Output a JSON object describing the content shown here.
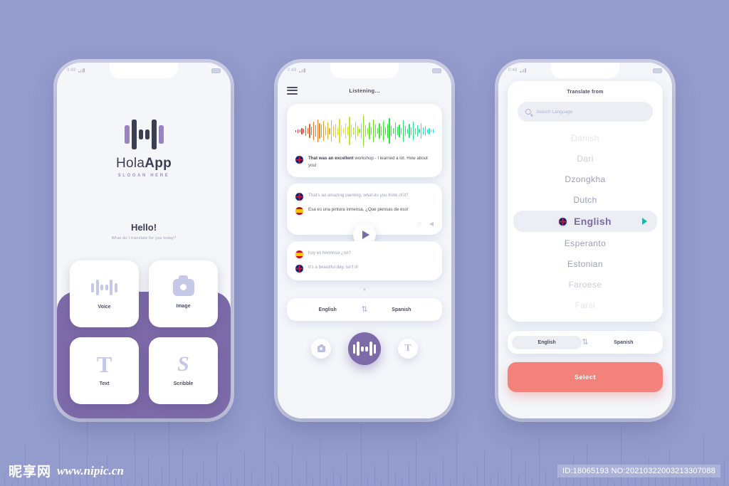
{
  "background": {
    "color": "#949ccd",
    "bar_color": "#8790c6"
  },
  "theme": {
    "purple": "#7d6aa8",
    "coral": "#f4827c",
    "teal": "#1bb8a6",
    "icon_lavender": "#c6c8e8"
  },
  "status_bar": {
    "time": "0:48",
    "battery": "battery-icon",
    "signal": "signal-icon"
  },
  "phone1": {
    "brand_a": "Hola",
    "brand_b": "App",
    "slogan": "SLOGAN HERE",
    "greeting": "Hello!",
    "greeting_sub": "What do I translate for you today?",
    "cards": [
      {
        "label": "Voice",
        "icon": "waveform-icon"
      },
      {
        "label": "Image",
        "icon": "camera-icon"
      },
      {
        "label": "Text",
        "icon": "text-icon"
      },
      {
        "label": "Scribble",
        "icon": "scribble-icon"
      }
    ]
  },
  "phone2": {
    "menu_icon": "hamburger-icon",
    "title": "Listening...",
    "waveform": "rainbow-waveform",
    "bubble1": {
      "flag": "flag-uk",
      "text_bold": "That was an excellent",
      "text_rest": " workshop - I learned a lot. How about you!"
    },
    "bubble2": {
      "line1": {
        "flag": "flag-uk",
        "text": "That's an amazing painting, what do you think of it?"
      },
      "line2": {
        "flag": "flag-es",
        "text": "Esa es una pintura inmensa, ¿Que piensas de eso!"
      },
      "action_like": "thumbs-up-icon",
      "action_share": "share-icon",
      "play": "play-icon"
    },
    "bubble3": {
      "line1": {
        "flag": "flag-es",
        "text": "hoy es hermoso ¿no?"
      },
      "line2": {
        "flag": "flag-uk",
        "text": "It's a beautiful day, isn't it!"
      },
      "chevron": "chevron-down-icon"
    },
    "lang_from": "English",
    "lang_to": "Spanish",
    "swap_icon": "swap-icon",
    "nav": [
      {
        "name": "camera",
        "icon": "camera-icon",
        "active": false
      },
      {
        "name": "voice",
        "icon": "waveform-icon",
        "active": true
      },
      {
        "name": "text",
        "icon": "text-icon",
        "active": false
      }
    ]
  },
  "phone3": {
    "title": "Translate from",
    "search_placeholder": "Search Language",
    "search_icon": "search-icon",
    "languages": [
      {
        "name": "Danish",
        "state": "faded-top"
      },
      {
        "name": "Dari",
        "state": "f1"
      },
      {
        "name": "Dzongkha",
        "state": "f2"
      },
      {
        "name": "Dutch",
        "state": "f2"
      },
      {
        "name": "English",
        "state": "selected",
        "flag": "flag-uk",
        "arrow": "play-arrow-icon"
      },
      {
        "name": "Esperanto",
        "state": "f2"
      },
      {
        "name": "Estonian",
        "state": "f2"
      },
      {
        "name": "Faroese",
        "state": "f3"
      },
      {
        "name": "Farsi",
        "state": "f4"
      }
    ],
    "lang_from": "English",
    "lang_to": "Spanish",
    "swap_icon": "swap-icon",
    "select_label": "Select"
  },
  "watermark": {
    "site_cn": "昵享网",
    "url": "www.nipic.cn",
    "id": "ID:18065193 NO:20210322003213307088"
  }
}
